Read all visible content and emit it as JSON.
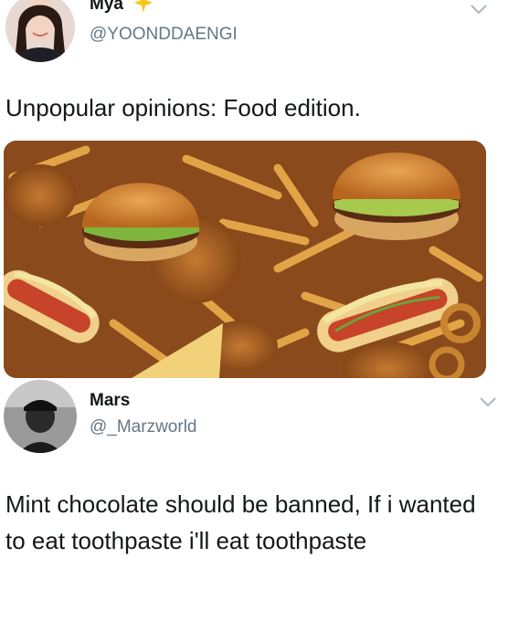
{
  "tweet1": {
    "display_name": "Mya",
    "handle": "@YOONDDAENGI",
    "text": "Unpopular opinions: Food edition.",
    "name_emoji": "sparkles-icon",
    "media_alt": "fast food pile: burgers, fries, hot dogs, fried chicken, nachos"
  },
  "tweet2": {
    "display_name": "Mars",
    "handle": "@_Marzworld",
    "text": "Mint chocolate should be banned, If i wanted to eat toothpaste i'll eat toothpaste"
  },
  "colors": {
    "text": "#14171a",
    "secondary": "#657786",
    "chevron": "#aab8c2",
    "sparkle": "#f5c518"
  }
}
